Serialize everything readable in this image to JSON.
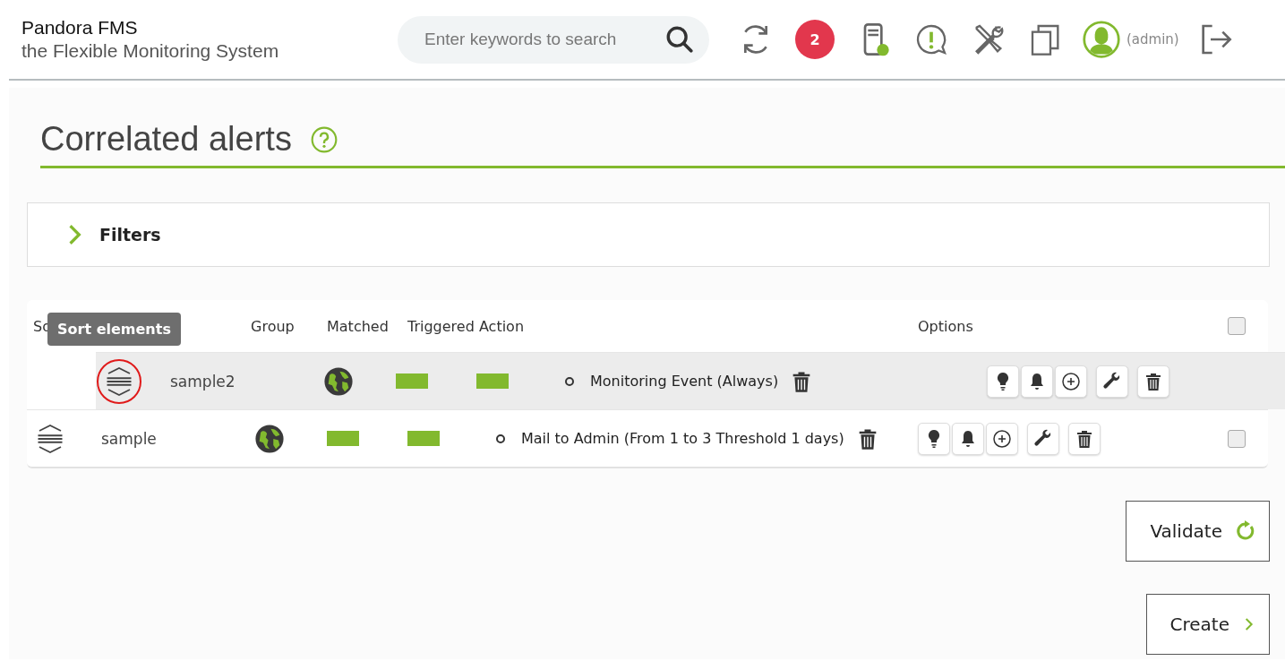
{
  "header": {
    "brand": "Pandora FMS",
    "tagline": "the Flexible Monitoring System",
    "search": {
      "placeholder": "Enter keywords to search"
    },
    "notifications": "2",
    "user": "(admin)"
  },
  "page": {
    "title": "Correlated alerts"
  },
  "filters": {
    "label": "Filters",
    "expanded": false
  },
  "table": {
    "columns": [
      {
        "label": "So",
        "kind": "sort"
      },
      {
        "label": "Group",
        "kind": "group"
      },
      {
        "label": "Matched",
        "kind": "matched"
      },
      {
        "label": "Triggered Action",
        "kind": "triggered"
      },
      {
        "label": "Options",
        "kind": "options"
      }
    ],
    "all_checked": false,
    "tooltip": "Sort elements",
    "rows": [
      {
        "name": "sample2",
        "dragging": true,
        "action": "Monitoring Event (Always)"
      },
      {
        "name": "sample",
        "dragging": false,
        "action": "Mail to Admin (From 1 to 3 Threshold 1 days)",
        "checked": false
      }
    ]
  },
  "buttons": [
    {
      "label": "Validate",
      "kind": "validate"
    },
    {
      "label": "Create",
      "kind": "create"
    }
  ]
}
